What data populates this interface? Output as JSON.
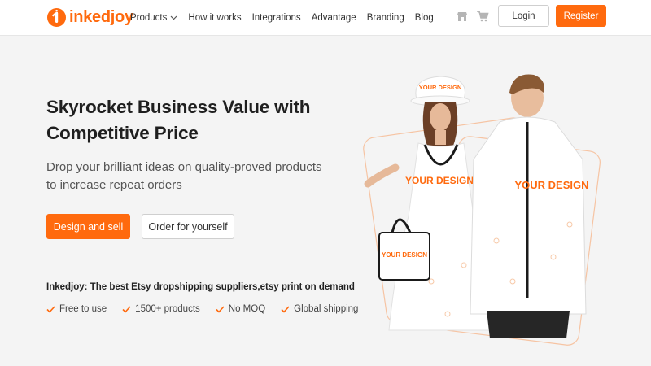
{
  "brand": {
    "name": "inkedjoy",
    "color": "#ff6a0e"
  },
  "nav": {
    "items": [
      {
        "label": "Products",
        "has_dropdown": true
      },
      {
        "label": "How it works"
      },
      {
        "label": "Integrations"
      },
      {
        "label": "Advantage"
      },
      {
        "label": "Branding"
      },
      {
        "label": "Blog"
      }
    ],
    "icons": [
      "store-icon",
      "cart-icon"
    ],
    "login_label": "Login",
    "register_label": "Register"
  },
  "hero": {
    "title": "Skyrocket Business Value with Competitive Price",
    "subtitle": "Drop your brilliant ideas on quality-proved products to increase repeat orders",
    "primary_cta": "Design and sell",
    "secondary_cta": "Order for yourself",
    "tagline": "Inkedjoy: The best Etsy dropshipping suppliers,etsy print on demand",
    "features": [
      "Free to use",
      "1500+ products",
      "No MOQ",
      "Global shipping"
    ],
    "product_print": "YOUR DESIGN"
  },
  "colors": {
    "accent": "#ff6a0e",
    "background": "#f4f4f4",
    "header_bg": "#ffffff"
  }
}
